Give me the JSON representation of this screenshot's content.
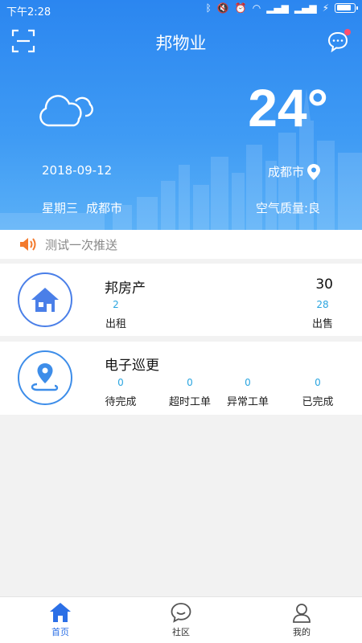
{
  "status_bar": {
    "time": "下午2:28"
  },
  "header": {
    "title": "邦物业"
  },
  "weather": {
    "temperature": "24°",
    "date": "2018-09-12",
    "city": "成都市",
    "weekday": "星期三",
    "city_bottom": "成都市",
    "air_quality": "空气质量:良",
    "icon": "cloud-icon"
  },
  "notice": {
    "text": "测试一次推送",
    "icon": "speaker-icon"
  },
  "real_estate": {
    "title": "邦房产",
    "total": "30",
    "rent": {
      "value": "2",
      "label": "出租"
    },
    "sale": {
      "value": "28",
      "label": "出售"
    },
    "icon": "house-icon"
  },
  "patrol": {
    "title": "电子巡更",
    "icon": "location-route-icon",
    "stats": [
      {
        "value": "0",
        "label": "待完成"
      },
      {
        "value": "0",
        "label": "超时工单"
      },
      {
        "value": "0",
        "label": "异常工单"
      },
      {
        "value": "0",
        "label": "已完成"
      }
    ]
  },
  "tabbar": {
    "items": [
      {
        "label": "首页",
        "icon": "home-icon",
        "active": true
      },
      {
        "label": "社区",
        "icon": "chat-bubble-icon",
        "active": false
      },
      {
        "label": "我的",
        "icon": "user-icon",
        "active": false
      }
    ]
  },
  "colors": {
    "primary": "#2b86f0",
    "accent": "#2aa5e0",
    "notice_icon": "#f37a2d"
  }
}
